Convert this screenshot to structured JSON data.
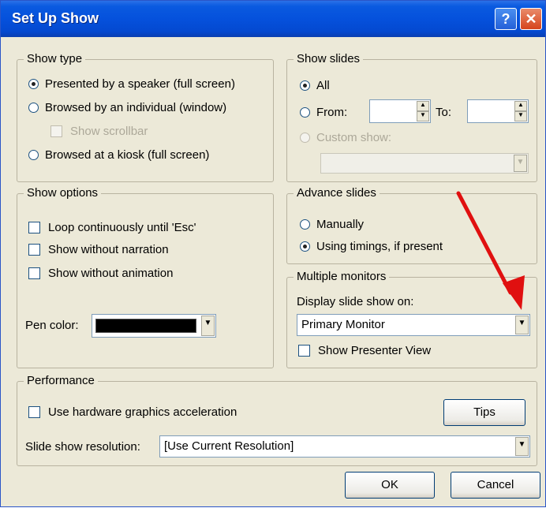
{
  "window": {
    "title": "Set Up Show",
    "help_glyph": "?",
    "close_glyph": "✕",
    "titlebar_color": "#0551dc"
  },
  "show_type": {
    "legend": "Show type",
    "options": [
      {
        "label": "Presented by a speaker (full screen)",
        "selected": true
      },
      {
        "label": "Browsed by an individual (window)",
        "selected": false
      },
      {
        "label": "Browsed at a kiosk (full screen)",
        "selected": false
      }
    ],
    "scrollbar_label": "Show scrollbar"
  },
  "show_slides": {
    "legend": "Show slides",
    "all_label": "All",
    "from_label": "From:",
    "to_label": "To:",
    "custom_label": "Custom show:",
    "from_value": "",
    "to_value": "",
    "selected": "All"
  },
  "show_options": {
    "legend": "Show options",
    "checks": [
      {
        "label": "Loop continuously until 'Esc'",
        "checked": false
      },
      {
        "label": "Show without narration",
        "checked": false
      },
      {
        "label": "Show without animation",
        "checked": false
      }
    ],
    "pen_color_label": "Pen color:",
    "pen_color": "#000000"
  },
  "advance_slides": {
    "legend": "Advance slides",
    "manually_label": "Manually",
    "timings_label": "Using timings, if present",
    "selected": "Using timings, if present"
  },
  "multiple_monitors": {
    "legend": "Multiple monitors",
    "display_label": "Display slide show on:",
    "display_value": "Primary Monitor",
    "presenter_view_label": "Show Presenter View"
  },
  "performance": {
    "legend": "Performance",
    "hw_accel_label": "Use hardware graphics acceleration",
    "tips_label": "Tips",
    "resolution_label": "Slide show resolution:",
    "resolution_value": "[Use Current Resolution]"
  },
  "buttons": {
    "ok": "OK",
    "cancel": "Cancel"
  },
  "annotation": {
    "arrow_color": "#e01010"
  },
  "icons": {
    "dropdown": "▼",
    "spin_up": "▲",
    "spin_down": "▼"
  }
}
